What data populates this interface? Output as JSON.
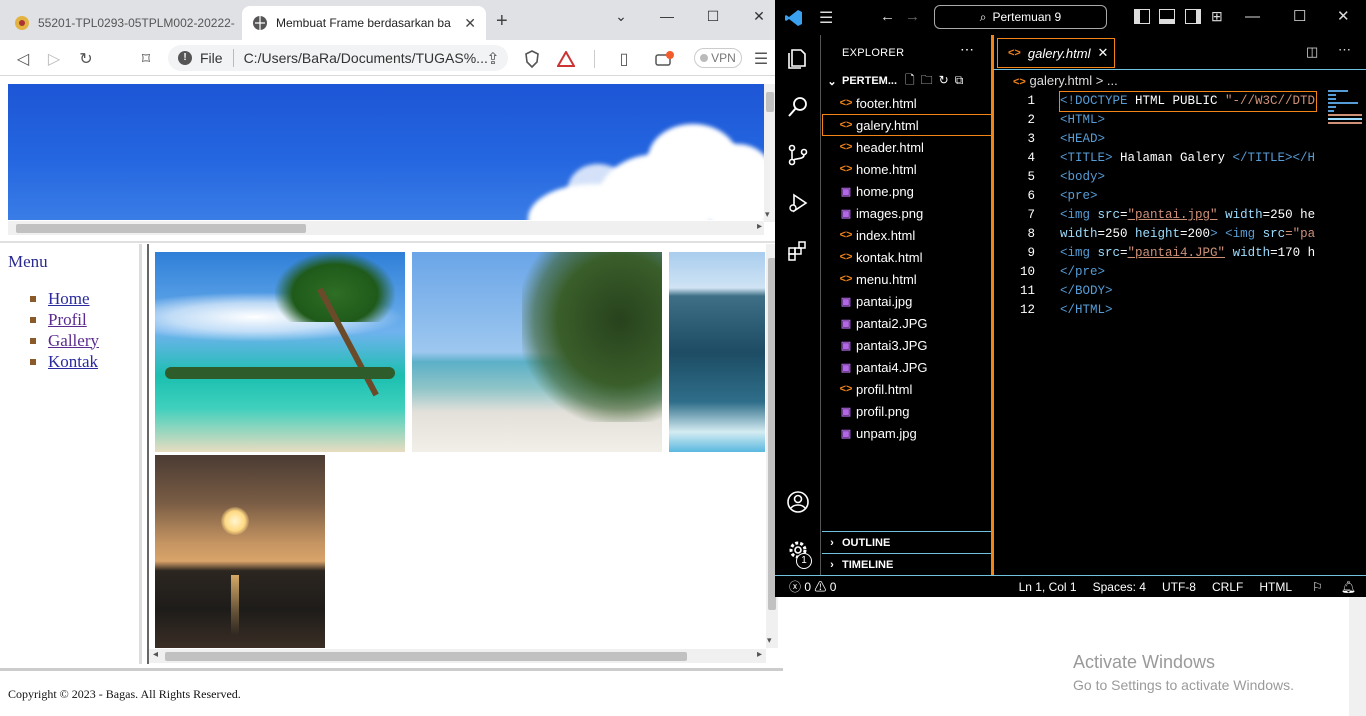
{
  "browser": {
    "tabs": [
      {
        "title": "55201-TPL0293-05TPLM002-20222-"
      },
      {
        "title": "Membuat Frame berdasarkan ba"
      }
    ],
    "new_tab": "+",
    "address": {
      "scheme": "File",
      "path": "C:/Users/BaRa/Documents/TUGAS%..."
    },
    "vpn": "VPN"
  },
  "page": {
    "menu_title": "Menu",
    "menu_items": [
      "Home",
      "Profil",
      "Gallery",
      "Kontak"
    ],
    "footer": "Copyright © 2023 - Bagas. All Rights Reserved."
  },
  "vscode": {
    "search": "Pertemuan 9",
    "explorer_title": "EXPLORER",
    "folder": "PERTEM...",
    "files": [
      {
        "name": "footer.html",
        "type": "html"
      },
      {
        "name": "galery.html",
        "type": "html",
        "selected": true
      },
      {
        "name": "header.html",
        "type": "html"
      },
      {
        "name": "home.html",
        "type": "html"
      },
      {
        "name": "home.png",
        "type": "image"
      },
      {
        "name": "images.png",
        "type": "image"
      },
      {
        "name": "index.html",
        "type": "html"
      },
      {
        "name": "kontak.html",
        "type": "html"
      },
      {
        "name": "menu.html",
        "type": "html"
      },
      {
        "name": "pantai.jpg",
        "type": "image"
      },
      {
        "name": "pantai2.JPG",
        "type": "image"
      },
      {
        "name": "pantai3.JPG",
        "type": "image"
      },
      {
        "name": "pantai4.JPG",
        "type": "image"
      },
      {
        "name": "profil.html",
        "type": "html"
      },
      {
        "name": "profil.png",
        "type": "image"
      },
      {
        "name": "unpam.jpg",
        "type": "image"
      }
    ],
    "outline": "OUTLINE",
    "timeline": "TIMELINE",
    "tab_title": "galery.html",
    "breadcrumb": "galery.html > ...",
    "line_numbers": [
      "1",
      "2",
      "3",
      "4",
      "5",
      "6",
      "7",
      "8",
      "9",
      "10",
      "11",
      "12"
    ],
    "code": {
      "l1a": "<!DOCTYPE ",
      "l1b": "HTML PUBLIC ",
      "l1c": "\"-//W3C//DTD",
      "l2": "<HTML>",
      "l3": "<HEAD>",
      "l4a": "<TITLE>",
      "l4b": " Halaman Galery ",
      "l4c": "</TITLE></H",
      "l5": "<body>",
      "l6": "<pre>",
      "l7a": "<img ",
      "l7b": "src",
      "l7c": "=",
      "l7d": "\"pantai.jpg\"",
      "l7e": " width",
      "l7f": "=250 he",
      "l8a": "width",
      "l8b": "=250 ",
      "l8c": "height",
      "l8d": "=200",
      "l8e": "> <img ",
      "l8f": "src",
      "l8g": "=\"pa",
      "l9a": "<img ",
      "l9b": "src",
      "l9c": "=",
      "l9d": "\"pantai4.JPG\"",
      "l9e": " width",
      "l9f": "=170 h",
      "l10": "</pre>",
      "l11": "</BODY>",
      "l12": "</HTML>"
    },
    "status": {
      "problems": "0",
      "warnings": "0",
      "position": "Ln 1, Col 1",
      "spaces": "Spaces: 4",
      "encoding": "UTF-8",
      "eol": "CRLF",
      "language": "HTML",
      "settings_badge": "1"
    }
  },
  "desktop": {
    "watermark_title": "Activate Windows",
    "watermark_sub": "Go to Settings to activate Windows."
  },
  "colors": {
    "accent": "#f38518",
    "link": "#2a2a9e",
    "vscode_border": "#6fc3df"
  }
}
